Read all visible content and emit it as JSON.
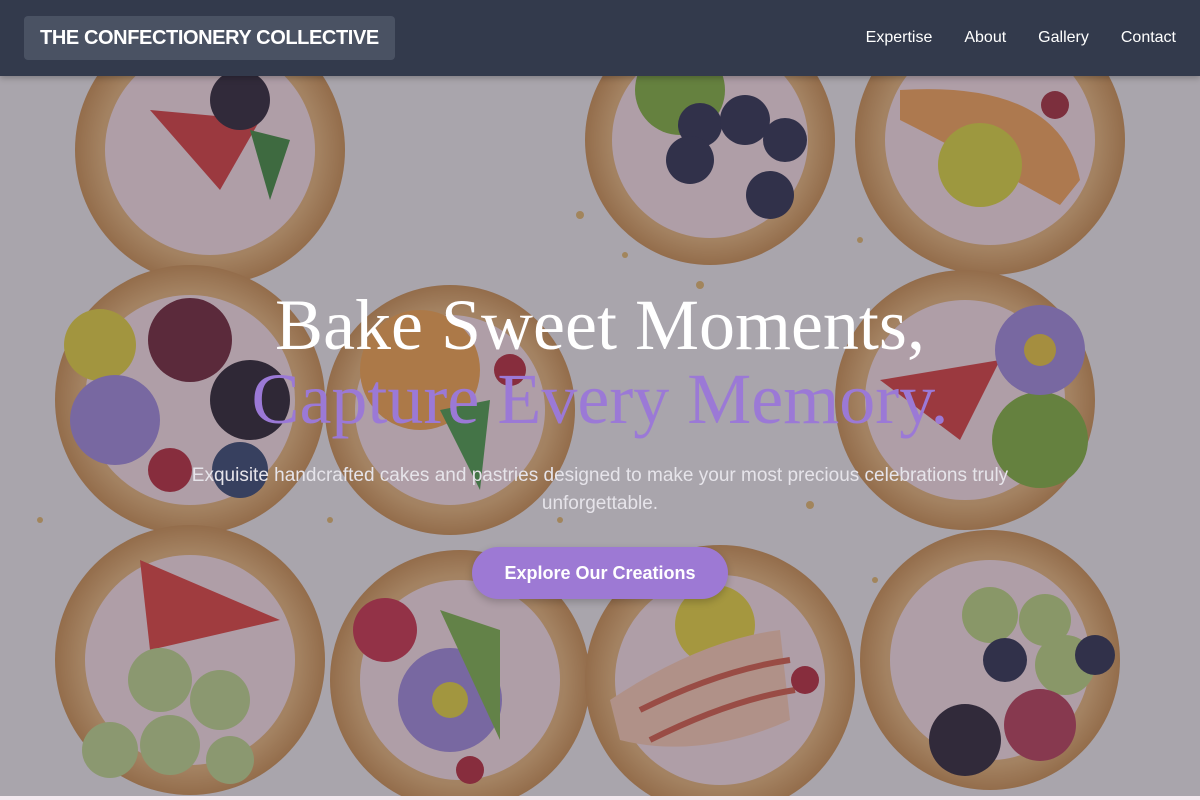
{
  "header": {
    "brand": "THE CONFECTIONERY COLLECTIVE",
    "nav": [
      {
        "label": "Expertise"
      },
      {
        "label": "About"
      },
      {
        "label": "Gallery"
      },
      {
        "label": "Contact"
      }
    ]
  },
  "hero": {
    "title_line1": "Bake Sweet Moments,",
    "title_line2": "Capture Every Memory.",
    "subtitle": "Exquisite handcrafted cakes and pastries designed to make your most precious celebrations truly unforgettable.",
    "cta_label": "Explore Our Creations"
  },
  "colors": {
    "header_bg": "#333a4c",
    "accent": "#9b79d6",
    "button_bg": "#9d79d4"
  }
}
